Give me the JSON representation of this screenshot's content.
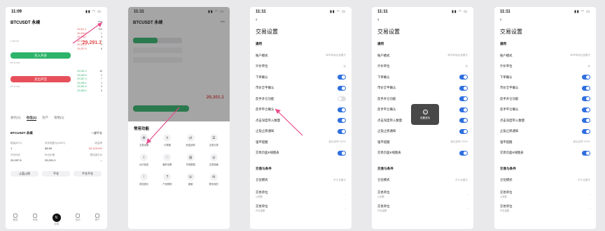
{
  "status": {
    "time": "11:09",
    "time_other": "11:11"
  },
  "p1": {
    "symbol": "BTCUSDT 永续",
    "price": "29,291.1",
    "open_long": "买入开多",
    "open_short": "卖出开空",
    "tabs": [
      "委托(0)",
      "仓位(1)",
      "资产",
      "策略(0)"
    ],
    "tab_active_index": 1,
    "position_symbol": "BTCUSDT 永续",
    "one_click": "一键平仓",
    "labels": [
      "数量(BTC)",
      "未实现盈亏(USDT)",
      "收益率"
    ],
    "values": [
      "1",
      "58.59",
      "52,429.6%"
    ],
    "labels2": [
      "开仓均价",
      "标记价格",
      "预估强平价"
    ],
    "values2": [
      "29,297.5",
      "29,291.1",
      "--"
    ],
    "actions": [
      "止盈止损",
      "平仓",
      "平仓平仓"
    ],
    "nav": [
      "首页",
      "市场",
      "交易",
      "合约",
      "资产"
    ],
    "asks": [
      "29,311.1",
      "29,309.0",
      "29,306.7",
      "29,304.1",
      "29,301.8",
      "29,297.5"
    ],
    "ask_vols": [
      "793",
      "1",
      "3",
      "2",
      "4",
      "8"
    ],
    "bids": [
      "29,291.0",
      "29,289.5",
      "29,287.3",
      "29,285.1",
      "29,281.5",
      "29,280.0"
    ],
    "bid_vols": [
      "18",
      "2",
      "7",
      "1",
      "3",
      "6"
    ]
  },
  "p2": {
    "symbol": "BTCUSDT 永续",
    "price": "29,301.1",
    "sheet_title": "常用功能",
    "items": [
      "交易设置",
      "计算器",
      "资金划转",
      "交易记录",
      "合约信息",
      "偏好设置",
      "市场数据",
      "交易指南",
      "风险提示",
      "产品帮助",
      "客服",
      "联系我们"
    ],
    "icons": [
      "⚙",
      "±",
      "⇄",
      "☰",
      "i",
      "♡",
      "▥",
      "◎",
      "!",
      "?",
      "☏",
      "✉"
    ]
  },
  "settings": {
    "title": "交易设置",
    "general": "通用",
    "rows": [
      {
        "label": "账户模式",
        "value": "单币种保证金模式"
      },
      {
        "label": "计价单位",
        "value": "张"
      },
      {
        "label": "下单确认",
        "toggle": true
      },
      {
        "label": "市价全平确认",
        "toggle": true
      },
      {
        "label": "反手开仓功能",
        "toggle": false
      },
      {
        "label": "反手平仓确认",
        "toggle": true
      },
      {
        "label": "点击深度带入数量",
        "toggle": true
      },
      {
        "label": "止盈止损通知",
        "toggle": true
      },
      {
        "label": "强平提醒",
        "value": "保证金率 300%"
      },
      {
        "label": "交易页面K线图表",
        "toggle": true
      }
    ],
    "section2": "交易与条件",
    "rows2": [
      {
        "label": "仓位模式",
        "value": "开平仓模式"
      },
      {
        "label": "交易单位",
        "sub": "以张数"
      },
      {
        "label": "交易单位",
        "sub": "开仓金额"
      }
    ],
    "toast": "设置成功"
  }
}
